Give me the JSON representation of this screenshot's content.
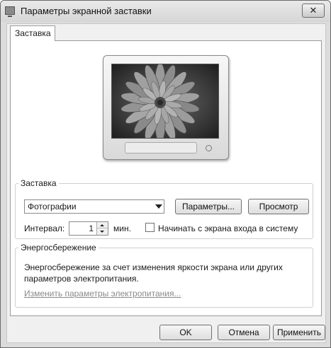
{
  "window": {
    "title": "Параметры экранной заставки",
    "close_label": "✕"
  },
  "tabs": [
    {
      "label": "Заставка",
      "selected": true
    }
  ],
  "preview": {
    "image": "chrysanthemum-photo"
  },
  "screensaver_group": {
    "legend": "Заставка",
    "selected": "Фотографии",
    "params_button": "Параметры...",
    "preview_button": "Просмотр",
    "interval_label": "Интервал:",
    "interval_value": "1",
    "interval_unit": "мин.",
    "logon_checkbox_label": "Начинать с экрана входа в систему",
    "logon_checkbox_checked": false
  },
  "power_group": {
    "legend": "Энергосбережение",
    "text_line1": "Энергосбережение за счет изменения яркости экрана или других",
    "text_line2": "параметров электропитания.",
    "link": "Изменить параметры электропитания..."
  },
  "footer": {
    "ok": "OK",
    "cancel": "Отмена",
    "apply": "Применить"
  }
}
